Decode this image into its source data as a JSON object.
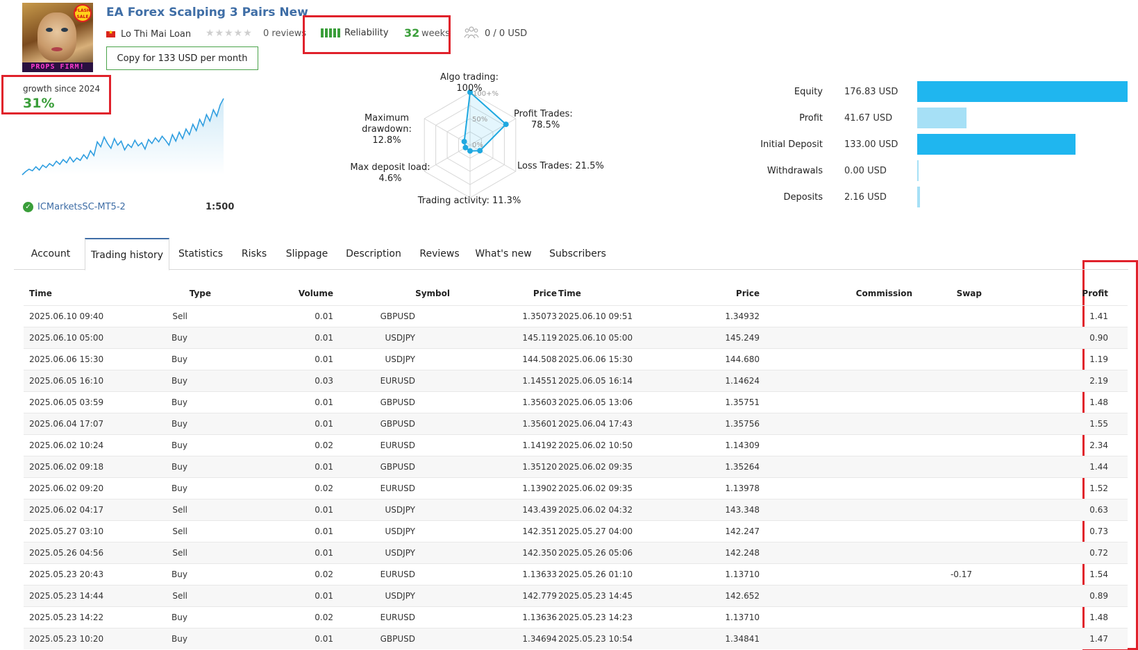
{
  "header": {
    "title": "EA Forex Scalping 3 Pairs New",
    "author": "Lo Thi Mai Loan",
    "reviews": "0 reviews",
    "reliability_label": "Reliability",
    "weeks_value": "32",
    "weeks_label": "weeks",
    "subscribers": "0 / 0 USD",
    "copy_button": "Copy for 133 USD per month",
    "avatar_badge": "FLASH SALE",
    "avatar_caption": "PROPS FIRM!"
  },
  "growth": {
    "label": "growth since 2024",
    "value": "31%",
    "broker": "ICMarketsSC-MT5-2",
    "leverage": "1:500",
    "series": [
      5,
      9,
      12,
      10,
      15,
      11,
      17,
      14,
      19,
      16,
      22,
      18,
      24,
      20,
      27,
      21,
      26,
      23,
      30,
      25,
      35,
      29,
      46,
      40,
      52,
      44,
      38,
      50,
      42,
      47,
      36,
      43,
      39,
      48,
      41,
      45,
      37,
      49,
      44,
      51,
      46,
      53,
      48,
      42,
      55,
      47,
      58,
      50,
      62,
      55,
      68,
      60,
      74,
      66,
      80,
      72,
      86,
      78,
      92,
      100
    ]
  },
  "radar": {
    "algo_trading": "Algo trading: 100%",
    "profit_trades_1": "Profit Trades:",
    "profit_trades_2": "78.5%",
    "loss_trades": "Loss Trades: 21.5%",
    "trading_activity": "Trading activity: 11.3%",
    "max_deposit_load_1": "Max deposit load:",
    "max_deposit_load_2": "4.6%",
    "max_drawdown_1": "Maximum",
    "max_drawdown_2": "drawdown: 12.8%",
    "scale_100": "100+%",
    "scale_50": "50%",
    "scale_0": "0%",
    "values": [
      100,
      78.5,
      21.5,
      11.3,
      4.6,
      12.8
    ]
  },
  "balance": [
    {
      "label": "Equity",
      "value": "176.83 USD",
      "amount": 176.83,
      "color": "#1fb6ef"
    },
    {
      "label": "Profit",
      "value": "41.67 USD",
      "amount": 41.67,
      "color": "#a6e0f6"
    },
    {
      "label": "Initial Deposit",
      "value": "133.00 USD",
      "amount": 133.0,
      "color": "#1fb6ef"
    },
    {
      "label": "Withdrawals",
      "value": "0.00 USD",
      "amount": 0.0,
      "color": "#a6e0f6"
    },
    {
      "label": "Deposits",
      "value": "2.16 USD",
      "amount": 2.16,
      "color": "#a6e0f6"
    }
  ],
  "tabs": [
    "Account",
    "Trading history",
    "Statistics",
    "Risks",
    "Slippage",
    "Description",
    "Reviews",
    "What's new",
    "Subscribers"
  ],
  "table": {
    "headers": [
      "Time",
      "Type",
      "Volume",
      "Symbol",
      "Price",
      "Time",
      "Price",
      "Commission",
      "Swap",
      "Profit"
    ],
    "rows": [
      [
        "2025.06.10 09:40",
        "Sell",
        "0.01",
        "GBPUSD",
        "1.35073",
        "2025.06.10 09:51",
        "1.34932",
        "",
        "",
        "1.41"
      ],
      [
        "2025.06.10 05:00",
        "Buy",
        "0.01",
        "USDJPY",
        "145.119",
        "2025.06.10 05:00",
        "145.249",
        "",
        "",
        "0.90"
      ],
      [
        "2025.06.06 15:30",
        "Buy",
        "0.01",
        "USDJPY",
        "144.508",
        "2025.06.06 15:30",
        "144.680",
        "",
        "",
        "1.19"
      ],
      [
        "2025.06.05 16:10",
        "Buy",
        "0.03",
        "EURUSD",
        "1.14551",
        "2025.06.05 16:14",
        "1.14624",
        "",
        "",
        "2.19"
      ],
      [
        "2025.06.05 03:59",
        "Buy",
        "0.01",
        "GBPUSD",
        "1.35603",
        "2025.06.05 13:06",
        "1.35751",
        "",
        "",
        "1.48"
      ],
      [
        "2025.06.04 17:07",
        "Buy",
        "0.01",
        "GBPUSD",
        "1.35601",
        "2025.06.04 17:43",
        "1.35756",
        "",
        "",
        "1.55"
      ],
      [
        "2025.06.02 10:24",
        "Buy",
        "0.02",
        "EURUSD",
        "1.14192",
        "2025.06.02 10:50",
        "1.14309",
        "",
        "",
        "2.34"
      ],
      [
        "2025.06.02 09:18",
        "Buy",
        "0.01",
        "GBPUSD",
        "1.35120",
        "2025.06.02 09:35",
        "1.35264",
        "",
        "",
        "1.44"
      ],
      [
        "2025.06.02 09:20",
        "Buy",
        "0.02",
        "EURUSD",
        "1.13902",
        "2025.06.02 09:35",
        "1.13978",
        "",
        "",
        "1.52"
      ],
      [
        "2025.06.02 04:17",
        "Sell",
        "0.01",
        "USDJPY",
        "143.439",
        "2025.06.02 04:32",
        "143.348",
        "",
        "",
        "0.63"
      ],
      [
        "2025.05.27 03:10",
        "Sell",
        "0.01",
        "USDJPY",
        "142.351",
        "2025.05.27 04:00",
        "142.247",
        "",
        "",
        "0.73"
      ],
      [
        "2025.05.26 04:56",
        "Sell",
        "0.01",
        "USDJPY",
        "142.350",
        "2025.05.26 05:06",
        "142.248",
        "",
        "",
        "0.72"
      ],
      [
        "2025.05.23 20:43",
        "Buy",
        "0.02",
        "EURUSD",
        "1.13633",
        "2025.05.26 01:10",
        "1.13710",
        "",
        "-0.17",
        "1.54"
      ],
      [
        "2025.05.23 14:44",
        "Sell",
        "0.01",
        "USDJPY",
        "142.779",
        "2025.05.23 14:45",
        "142.652",
        "",
        "",
        "0.89"
      ],
      [
        "2025.05.23 14:22",
        "Buy",
        "0.02",
        "EURUSD",
        "1.13636",
        "2025.05.23 14:23",
        "1.13710",
        "",
        "",
        "1.48"
      ],
      [
        "2025.05.23 10:20",
        "Buy",
        "0.01",
        "GBPUSD",
        "1.34694",
        "2025.05.23 10:54",
        "1.34841",
        "",
        "",
        "1.47"
      ]
    ]
  },
  "colors": {
    "accent": "#3f6ea6",
    "positive": "#3a9e3a",
    "negative": "#c0262d",
    "highlight_box": "#e0212b"
  }
}
